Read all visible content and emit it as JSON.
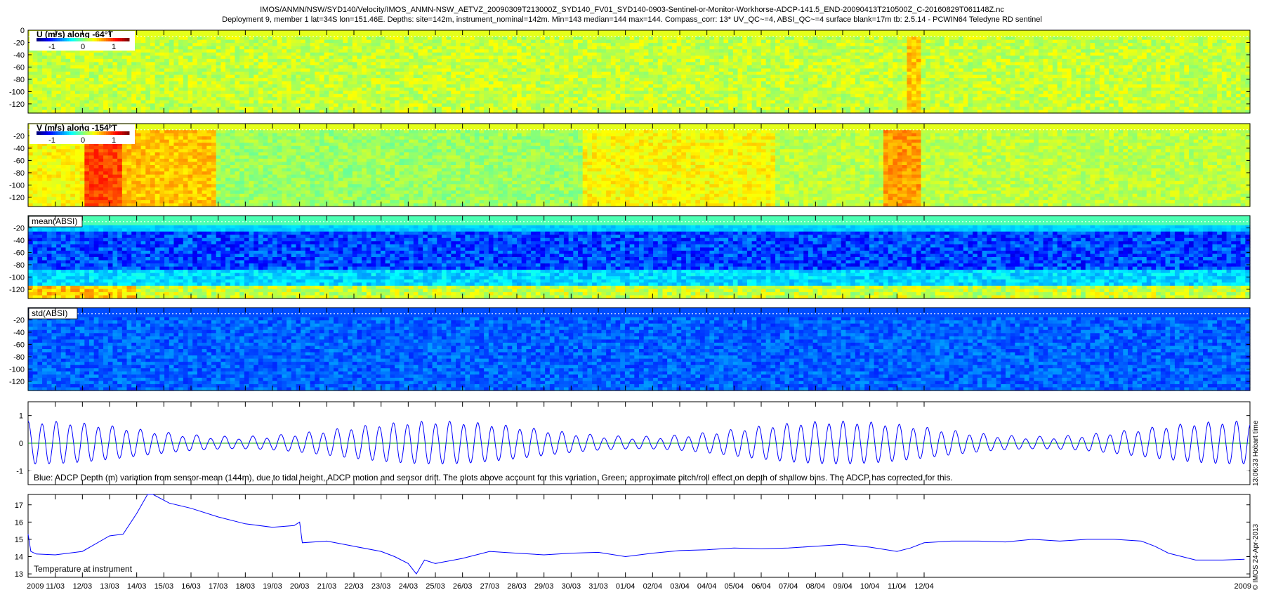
{
  "header": {
    "line1": "IMOS/ANMN/NSW/SYD140/Velocity/IMOS_ANMN-NSW_AETVZ_20090309T213000Z_SYD140_FV01_SYD140-0903-Sentinel-or-Monitor-Workhorse-ADCP-141.5_END-20090413T210500Z_C-20160829T061148Z.nc",
    "line2": "Deployment 9, member 1 lat=34S lon=151.46E. Depths: site=142m, instrument_nominal=142m. Min=143 median=144 max=144. Compass_corr: 13* UV_QC~=4, ABSI_QC~=4 surface blank=17m tb: 2.5.14 - PCWIN64 Teledyne RD sentinel"
  },
  "side_text": {
    "timezone": "13:06:33 Hobart time",
    "credit": "© IMOS 24-Apr-2013"
  },
  "colors": {
    "line_blue": "#0000ff",
    "line_green": "#00a000",
    "jet": [
      "#00008f",
      "#0000ff",
      "#0080ff",
      "#00ffff",
      "#80ff80",
      "#ffff00",
      "#ff8000",
      "#ff0000",
      "#800000"
    ]
  },
  "time_axis": {
    "year_label": "2009",
    "tick_labels": [
      "11/03",
      "12/03",
      "13/03",
      "14/03",
      "15/03",
      "16/03",
      "17/03",
      "18/03",
      "19/03",
      "20/03",
      "21/03",
      "22/03",
      "23/03",
      "24/03",
      "25/03",
      "26/03",
      "27/03",
      "28/03",
      "29/03",
      "30/03",
      "31/03",
      "01/04",
      "02/04",
      "03/04",
      "04/04",
      "05/04",
      "06/04",
      "07/04",
      "08/04",
      "09/04",
      "10/04",
      "11/04",
      "12/04"
    ],
    "end_label": "2009"
  },
  "chart_data": [
    {
      "type": "heatmap",
      "panel": "u",
      "title": "U (m/s) along -64°T",
      "colorbar": {
        "ticks": [
          "-1",
          "0",
          "1"
        ],
        "range": [
          -1.5,
          1.5
        ]
      },
      "y_ticks": [
        "0",
        "-20",
        "-40",
        "-60",
        "-80",
        "-100",
        "-120"
      ],
      "ylim": [
        -135,
        0
      ],
      "colormap": "jet",
      "features": [
        {
          "day_from": 0.0,
          "day_to": 35.5,
          "value": 0.15,
          "desc": "near zero throughout"
        },
        {
          "day_from": 32.4,
          "day_to": 32.9,
          "value": 0.55
        }
      ]
    },
    {
      "type": "heatmap",
      "panel": "v",
      "title": "V (m/s) along -154°T",
      "colorbar": {
        "ticks": [
          "-1",
          "0",
          "1"
        ],
        "range": [
          -1.5,
          1.5
        ]
      },
      "y_ticks": [
        "-20",
        "-40",
        "-60",
        "-80",
        "-100",
        "-120"
      ],
      "ylim": [
        -135,
        0
      ],
      "colormap": "jet",
      "features": [
        {
          "day_from": 0.0,
          "day_to": 2.0,
          "value": 0.45
        },
        {
          "day_from": 2.0,
          "day_to": 3.5,
          "value": 1.1
        },
        {
          "day_from": 3.5,
          "day_to": 7.0,
          "value": 0.65
        },
        {
          "day_from": 7.0,
          "day_to": 20.5,
          "value": 0.1
        },
        {
          "day_from": 20.5,
          "day_to": 27.5,
          "value": 0.45
        },
        {
          "day_from": 31.5,
          "day_to": 32.8,
          "value": 0.8
        }
      ]
    },
    {
      "type": "heatmap",
      "panel": "mean_absi",
      "title": "mean(ABSI)",
      "y_ticks": [
        "-20",
        "-40",
        "-60",
        "-80",
        "-100",
        "-120"
      ],
      "ylim": [
        -135,
        0
      ],
      "colormap": "jet",
      "features": [
        {
          "depth_from": -20,
          "depth_to": -25,
          "value": 0.45,
          "desc": "cyan band near top"
        },
        {
          "depth_from": -25,
          "depth_to": -90,
          "value": 0.12,
          "desc": "dark blue"
        },
        {
          "depth_from": -90,
          "depth_to": -110,
          "value": 0.35,
          "desc": "cyan/light blue"
        },
        {
          "depth_from": -110,
          "depth_to": -130,
          "value": 0.55,
          "desc": "green/yellow near bottom"
        }
      ]
    },
    {
      "type": "heatmap",
      "panel": "std_absi",
      "title": "std(ABSI)",
      "y_ticks": [
        "-20",
        "-40",
        "-60",
        "-80",
        "-100",
        "-120"
      ],
      "ylim": [
        -135,
        0
      ],
      "colormap": "jet",
      "features": [
        {
          "depth_from": -15,
          "depth_to": -130,
          "value": 0.22,
          "desc": "mostly blue with noise"
        }
      ]
    },
    {
      "type": "line",
      "panel": "depth",
      "annotation": "Blue: ADCP Depth (m) variation from sensor-mean (144m), due to tidal height, ADCP motion and sensor drift. The plots above account for this variation. Green: approximate pitch/roll effect on depth of shallow bins. The ADCP has corrected for this.",
      "y_ticks": [
        "1",
        "0",
        "-1"
      ],
      "ylim": [
        -1.5,
        1.5
      ],
      "series": [
        {
          "color": "blue",
          "kind": "tidal",
          "period_days": 0.5175,
          "amplitude_min": 0.2,
          "amplitude_max": 0.75,
          "spring_neap_period_days": 14.77
        },
        {
          "color": "green",
          "kind": "constant",
          "value": 0.0
        }
      ]
    },
    {
      "type": "line",
      "panel": "temperature",
      "annotation": "Temperature at instrument",
      "y_ticks": [
        "17",
        "16",
        "15",
        "14",
        "13"
      ],
      "ylim": [
        12.8,
        17.6
      ],
      "x_unit": "days since 10/03/2009",
      "series": [
        {
          "color": "blue",
          "points": [
            [
              0,
              15.3
            ],
            [
              0.1,
              14.3
            ],
            [
              0.3,
              14.15
            ],
            [
              1.0,
              14.1
            ],
            [
              2.0,
              14.3
            ],
            [
              3.0,
              15.2
            ],
            [
              3.5,
              15.3
            ],
            [
              4.0,
              16.5
            ],
            [
              4.4,
              17.6
            ],
            [
              4.6,
              17.6
            ],
            [
              5.2,
              17.1
            ],
            [
              6.0,
              16.8
            ],
            [
              7.0,
              16.3
            ],
            [
              8.0,
              15.9
            ],
            [
              9.0,
              15.7
            ],
            [
              9.8,
              15.8
            ],
            [
              10.0,
              16.0
            ],
            [
              10.1,
              14.8
            ],
            [
              11.0,
              14.9
            ],
            [
              12.0,
              14.6
            ],
            [
              13.0,
              14.3
            ],
            [
              13.5,
              14.0
            ],
            [
              14.0,
              13.6
            ],
            [
              14.3,
              13.0
            ],
            [
              14.6,
              13.8
            ],
            [
              15.0,
              13.6
            ],
            [
              16.0,
              13.9
            ],
            [
              17.0,
              14.3
            ],
            [
              18.0,
              14.2
            ],
            [
              19.0,
              14.1
            ],
            [
              20.0,
              14.2
            ],
            [
              21.0,
              14.25
            ],
            [
              22.0,
              14.0
            ],
            [
              23.0,
              14.2
            ],
            [
              24.0,
              14.35
            ],
            [
              25.0,
              14.4
            ],
            [
              26.0,
              14.5
            ],
            [
              27.0,
              14.45
            ],
            [
              28.0,
              14.5
            ],
            [
              29.0,
              14.6
            ],
            [
              30.0,
              14.7
            ],
            [
              31.0,
              14.55
            ],
            [
              32.0,
              14.3
            ],
            [
              32.5,
              14.5
            ],
            [
              33.0,
              14.8
            ],
            [
              34.0,
              14.9
            ],
            [
              35.0,
              14.9
            ],
            [
              36.0,
              14.85
            ],
            [
              37.0,
              15.0
            ],
            [
              38.0,
              14.9
            ],
            [
              39.0,
              15.0
            ],
            [
              40.0,
              15.0
            ],
            [
              41.0,
              14.9
            ],
            [
              41.5,
              14.6
            ],
            [
              42.0,
              14.2
            ],
            [
              43.0,
              13.8
            ],
            [
              44.0,
              13.8
            ],
            [
              44.8,
              13.85
            ]
          ]
        }
      ]
    }
  ]
}
